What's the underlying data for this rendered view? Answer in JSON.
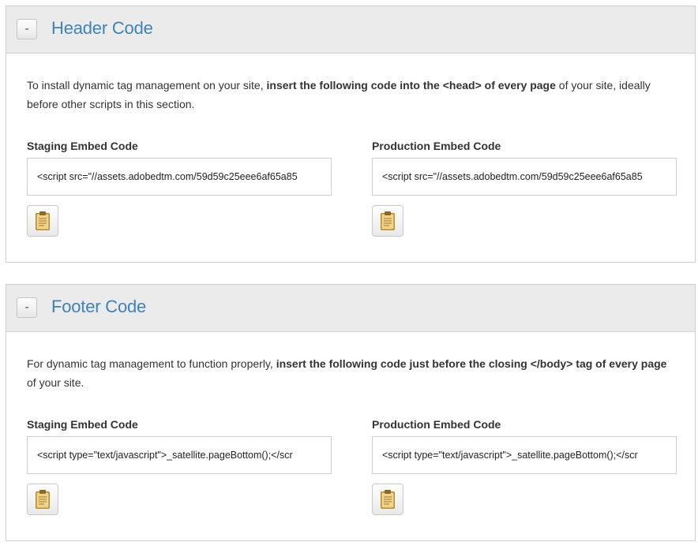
{
  "colors": {
    "title": "#3d82b8",
    "panel_header_bg": "#ebebeb",
    "border": "#cfcfcf",
    "clipboard": "#e8b94a"
  },
  "header_panel": {
    "toggle": "-",
    "title": "Header Code",
    "desc_pre": "To install dynamic tag management on your site, ",
    "desc_bold": "insert the following code into the <head> of every page",
    "desc_post": " of your site, ideally before other scripts in this section.",
    "staging_label": "Staging Embed Code",
    "staging_value": "<script src=\"//assets.adobedtm.com/59d59c25eee6af65a85",
    "production_label": "Production Embed Code",
    "production_value": "<script src=\"//assets.adobedtm.com/59d59c25eee6af65a85",
    "copy_icon": "clipboard-icon"
  },
  "footer_panel": {
    "toggle": "-",
    "title": "Footer Code",
    "desc_pre": "For dynamic tag management to function properly, ",
    "desc_bold": "insert the following code just before the closing </body> tag of every page",
    "desc_post": " of your site.",
    "staging_label": "Staging Embed Code",
    "staging_value": "<script type=\"text/javascript\">_satellite.pageBottom();</scr",
    "production_label": "Production Embed Code",
    "production_value": "<script type=\"text/javascript\">_satellite.pageBottom();</scr",
    "copy_icon": "clipboard-icon"
  }
}
